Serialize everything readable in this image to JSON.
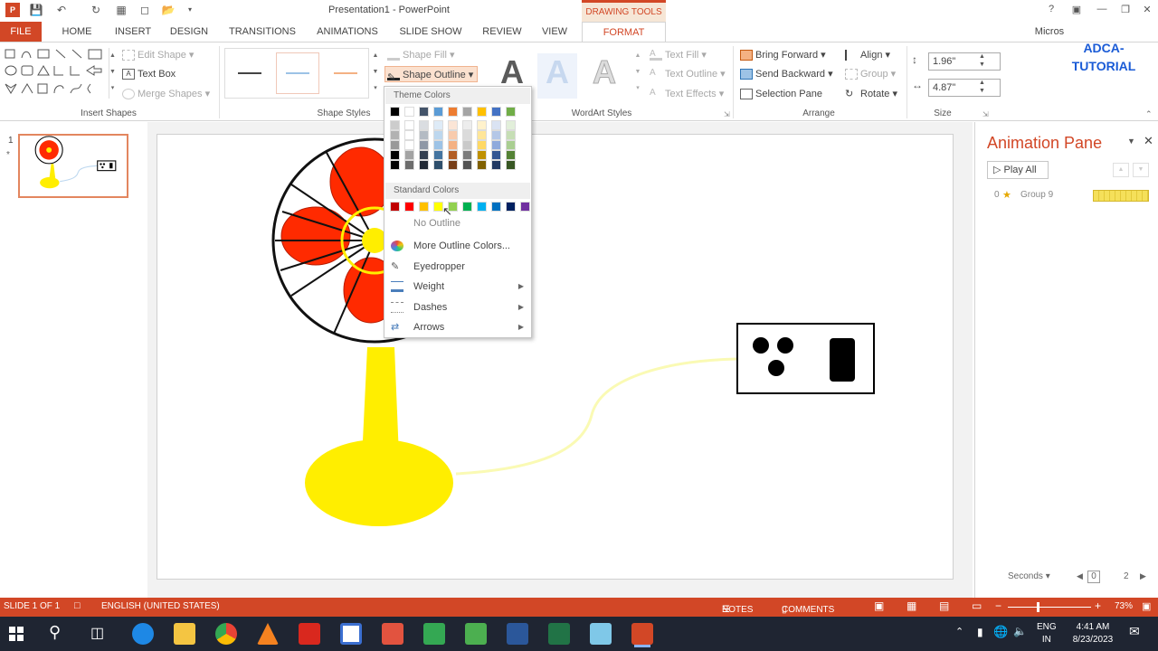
{
  "window": {
    "title": "Presentation1 - PowerPoint",
    "drawing_tools_label": "DRAWING TOOLS",
    "user_name": "Micros",
    "help": "?"
  },
  "tabs": [
    "FILE",
    "HOME",
    "INSERT",
    "DESIGN",
    "TRANSITIONS",
    "ANIMATIONS",
    "SLIDE SHOW",
    "REVIEW",
    "VIEW",
    "FORMAT"
  ],
  "ribbon": {
    "insert_shapes": {
      "label": "Insert Shapes",
      "edit_shape": "Edit Shape",
      "text_box": "Text Box",
      "merge_shapes": "Merge Shapes"
    },
    "shape_styles": {
      "label": "Shape Styles",
      "shape_fill": "Shape Fill",
      "shape_outline": "Shape Outline"
    },
    "wordart": {
      "label": "WordArt Styles",
      "text_fill": "Text Fill",
      "text_outline": "Text Outline",
      "text_effects": "Text Effects",
      "letter": "A"
    },
    "arrange": {
      "label": "Arrange",
      "bring_forward": "Bring Forward",
      "send_backward": "Send Backward",
      "selection_pane": "Selection Pane",
      "align": "Align",
      "group": "Group",
      "rotate": "Rotate"
    },
    "size": {
      "label": "Size",
      "height": "1.96\"",
      "width": "4.87\""
    }
  },
  "watermark": {
    "line1": "ADCA-",
    "line2": "TUTORIAL"
  },
  "outline_menu": {
    "theme_colors_label": "Theme Colors",
    "standard_colors_label": "Standard Colors",
    "theme_colors": [
      "#000000",
      "#ffffff",
      "#44546a",
      "#5b9bd5",
      "#ed7d31",
      "#a5a5a5",
      "#ffc000",
      "#4472c4",
      "#70ad47"
    ],
    "standard_colors": [
      "#c00000",
      "#ff0000",
      "#ffc000",
      "#ffff00",
      "#92d050",
      "#00b050",
      "#00b0f0",
      "#0070c0",
      "#002060",
      "#7030a0"
    ],
    "no_outline": "No Outline",
    "more_colors": "More Outline Colors...",
    "eyedropper": "Eyedropper",
    "weight": "Weight",
    "dashes": "Dashes",
    "arrows": "Arrows"
  },
  "slide_panel": {
    "number": "1",
    "star": "*"
  },
  "animation_pane": {
    "title": "Animation Pane",
    "play_all": "Play All",
    "item_index": "0",
    "item_name": "Group 9",
    "seconds_label": "Seconds",
    "timeline_start": "0",
    "timeline_end": "2"
  },
  "status": {
    "slide": "SLIDE 1 OF 1",
    "language": "ENGLISH (UNITED STATES)",
    "notes": "NOTES",
    "comments": "COMMENTS",
    "zoom": "73%"
  },
  "taskbar": {
    "lang1": "ENG",
    "lang2": "IN",
    "time": "4:41 AM",
    "date": "8/23/2023"
  },
  "colors": {
    "accent": "#d24726",
    "fan_blade": "#ff2a00",
    "fan_base": "#ffee00"
  }
}
